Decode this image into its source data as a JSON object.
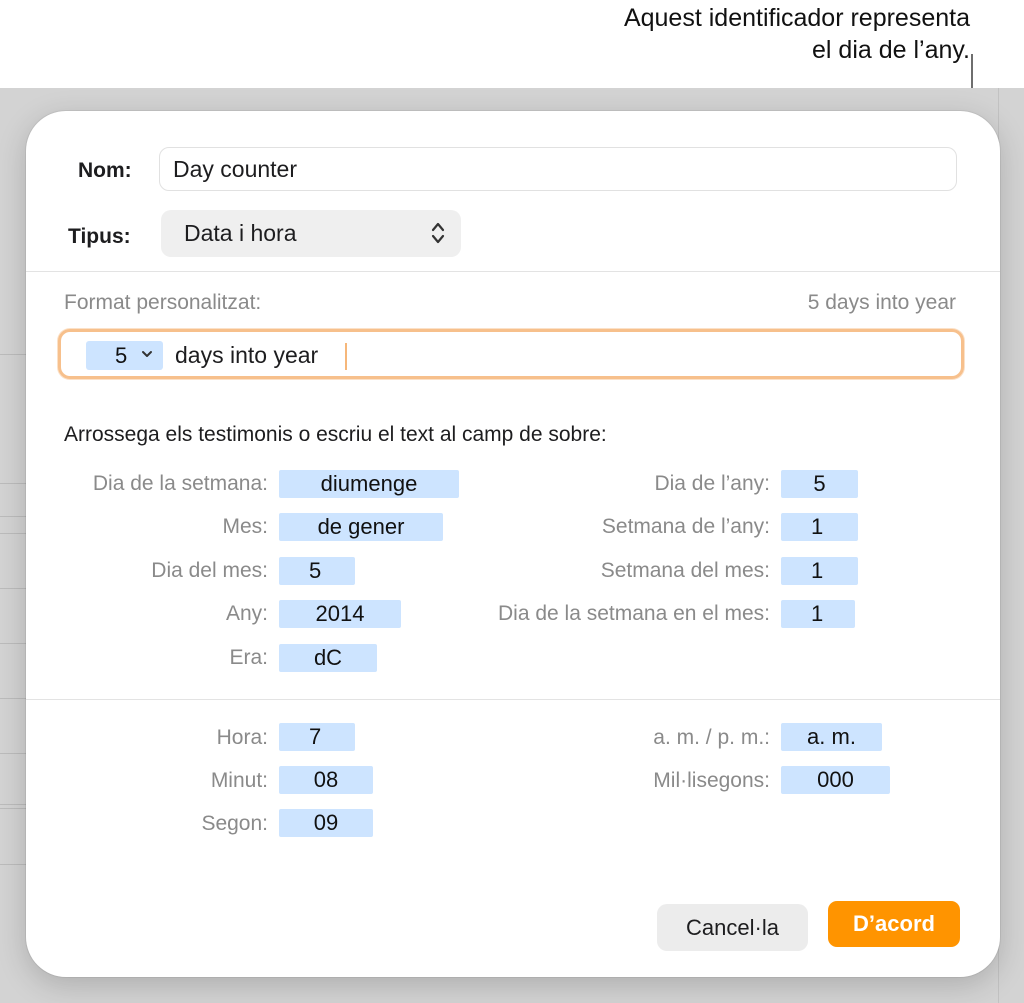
{
  "callout": {
    "line1": "Aquest identificador representa",
    "line2": "el dia de l’any."
  },
  "dialog": {
    "name_label": "Nom:",
    "name_value": "Day counter",
    "type_label": "Tipus:",
    "type_value": "Data i hora",
    "custom_format_label": "Format personalitzat:",
    "preview": "5 days into year",
    "format_field": {
      "token_value": "5",
      "text": "days into year"
    },
    "instructions": "Arrossega els testimonis o escriu el text al camp de sobre:",
    "date_tokens_left": [
      {
        "label": "Dia de la setmana:",
        "token": "diumenge"
      },
      {
        "label": "Mes:",
        "token": "de gener"
      },
      {
        "label": "Dia del mes:",
        "token": "5"
      },
      {
        "label": "Any:",
        "token": "2014"
      },
      {
        "label": "Era:",
        "token": "dC"
      }
    ],
    "date_tokens_right": [
      {
        "label": "Dia de l’any:",
        "token": "5"
      },
      {
        "label": "Setmana de l’any:",
        "token": "1"
      },
      {
        "label": "Setmana del mes:",
        "token": "1"
      },
      {
        "label": "Dia de la setmana en el mes:",
        "token": "1"
      }
    ],
    "time_tokens_left": [
      {
        "label": "Hora:",
        "token": "7"
      },
      {
        "label": "Minut:",
        "token": "08"
      },
      {
        "label": "Segon:",
        "token": "09"
      }
    ],
    "time_tokens_right": [
      {
        "label": "a. m. / p. m.:",
        "token": "a. m."
      },
      {
        "label": "Mil·lisegons:",
        "token": "000"
      }
    ],
    "cancel_label": "Cancel·la",
    "ok_label": "D’acord"
  },
  "colors": {
    "accent": "#ff9400",
    "token_bg": "#cde4ff",
    "focus_ring": "#f7c08c"
  }
}
